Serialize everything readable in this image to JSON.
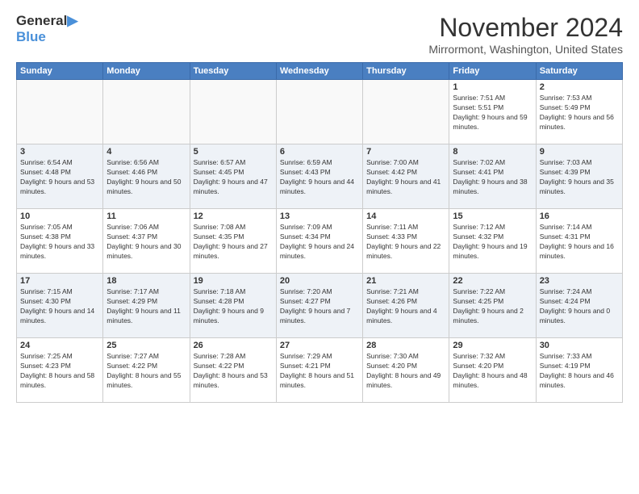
{
  "header": {
    "logo_line1": "General",
    "logo_line2": "Blue",
    "month_title": "November 2024",
    "location": "Mirrormont, Washington, United States"
  },
  "days_of_week": [
    "Sunday",
    "Monday",
    "Tuesday",
    "Wednesday",
    "Thursday",
    "Friday",
    "Saturday"
  ],
  "weeks": [
    [
      {
        "day": "",
        "info": ""
      },
      {
        "day": "",
        "info": ""
      },
      {
        "day": "",
        "info": ""
      },
      {
        "day": "",
        "info": ""
      },
      {
        "day": "",
        "info": ""
      },
      {
        "day": "1",
        "info": "Sunrise: 7:51 AM\nSunset: 5:51 PM\nDaylight: 9 hours and 59 minutes."
      },
      {
        "day": "2",
        "info": "Sunrise: 7:53 AM\nSunset: 5:49 PM\nDaylight: 9 hours and 56 minutes."
      }
    ],
    [
      {
        "day": "3",
        "info": "Sunrise: 6:54 AM\nSunset: 4:48 PM\nDaylight: 9 hours and 53 minutes."
      },
      {
        "day": "4",
        "info": "Sunrise: 6:56 AM\nSunset: 4:46 PM\nDaylight: 9 hours and 50 minutes."
      },
      {
        "day": "5",
        "info": "Sunrise: 6:57 AM\nSunset: 4:45 PM\nDaylight: 9 hours and 47 minutes."
      },
      {
        "day": "6",
        "info": "Sunrise: 6:59 AM\nSunset: 4:43 PM\nDaylight: 9 hours and 44 minutes."
      },
      {
        "day": "7",
        "info": "Sunrise: 7:00 AM\nSunset: 4:42 PM\nDaylight: 9 hours and 41 minutes."
      },
      {
        "day": "8",
        "info": "Sunrise: 7:02 AM\nSunset: 4:41 PM\nDaylight: 9 hours and 38 minutes."
      },
      {
        "day": "9",
        "info": "Sunrise: 7:03 AM\nSunset: 4:39 PM\nDaylight: 9 hours and 35 minutes."
      }
    ],
    [
      {
        "day": "10",
        "info": "Sunrise: 7:05 AM\nSunset: 4:38 PM\nDaylight: 9 hours and 33 minutes."
      },
      {
        "day": "11",
        "info": "Sunrise: 7:06 AM\nSunset: 4:37 PM\nDaylight: 9 hours and 30 minutes."
      },
      {
        "day": "12",
        "info": "Sunrise: 7:08 AM\nSunset: 4:35 PM\nDaylight: 9 hours and 27 minutes."
      },
      {
        "day": "13",
        "info": "Sunrise: 7:09 AM\nSunset: 4:34 PM\nDaylight: 9 hours and 24 minutes."
      },
      {
        "day": "14",
        "info": "Sunrise: 7:11 AM\nSunset: 4:33 PM\nDaylight: 9 hours and 22 minutes."
      },
      {
        "day": "15",
        "info": "Sunrise: 7:12 AM\nSunset: 4:32 PM\nDaylight: 9 hours and 19 minutes."
      },
      {
        "day": "16",
        "info": "Sunrise: 7:14 AM\nSunset: 4:31 PM\nDaylight: 9 hours and 16 minutes."
      }
    ],
    [
      {
        "day": "17",
        "info": "Sunrise: 7:15 AM\nSunset: 4:30 PM\nDaylight: 9 hours and 14 minutes."
      },
      {
        "day": "18",
        "info": "Sunrise: 7:17 AM\nSunset: 4:29 PM\nDaylight: 9 hours and 11 minutes."
      },
      {
        "day": "19",
        "info": "Sunrise: 7:18 AM\nSunset: 4:28 PM\nDaylight: 9 hours and 9 minutes."
      },
      {
        "day": "20",
        "info": "Sunrise: 7:20 AM\nSunset: 4:27 PM\nDaylight: 9 hours and 7 minutes."
      },
      {
        "day": "21",
        "info": "Sunrise: 7:21 AM\nSunset: 4:26 PM\nDaylight: 9 hours and 4 minutes."
      },
      {
        "day": "22",
        "info": "Sunrise: 7:22 AM\nSunset: 4:25 PM\nDaylight: 9 hours and 2 minutes."
      },
      {
        "day": "23",
        "info": "Sunrise: 7:24 AM\nSunset: 4:24 PM\nDaylight: 9 hours and 0 minutes."
      }
    ],
    [
      {
        "day": "24",
        "info": "Sunrise: 7:25 AM\nSunset: 4:23 PM\nDaylight: 8 hours and 58 minutes."
      },
      {
        "day": "25",
        "info": "Sunrise: 7:27 AM\nSunset: 4:22 PM\nDaylight: 8 hours and 55 minutes."
      },
      {
        "day": "26",
        "info": "Sunrise: 7:28 AM\nSunset: 4:22 PM\nDaylight: 8 hours and 53 minutes."
      },
      {
        "day": "27",
        "info": "Sunrise: 7:29 AM\nSunset: 4:21 PM\nDaylight: 8 hours and 51 minutes."
      },
      {
        "day": "28",
        "info": "Sunrise: 7:30 AM\nSunset: 4:20 PM\nDaylight: 8 hours and 49 minutes."
      },
      {
        "day": "29",
        "info": "Sunrise: 7:32 AM\nSunset: 4:20 PM\nDaylight: 8 hours and 48 minutes."
      },
      {
        "day": "30",
        "info": "Sunrise: 7:33 AM\nSunset: 4:19 PM\nDaylight: 8 hours and 46 minutes."
      }
    ]
  ]
}
